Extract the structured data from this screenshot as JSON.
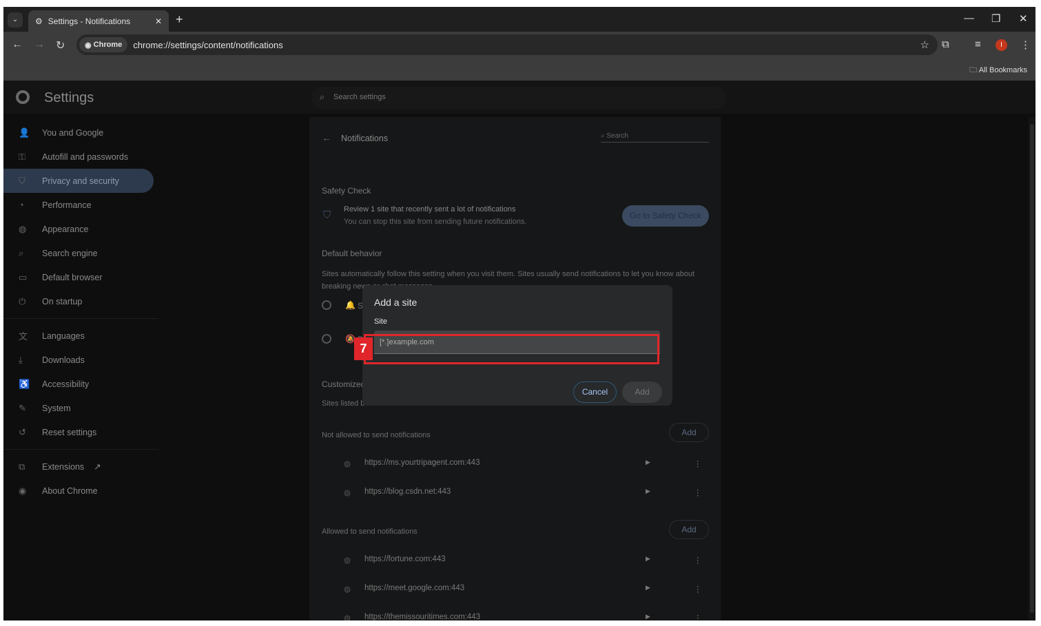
{
  "browser": {
    "tab_title": "Settings - Notifications",
    "chip_label": "Chrome",
    "url": "chrome://settings/content/notifications",
    "bookmarks_label": "All Bookmarks",
    "profile_initial": "I"
  },
  "settings": {
    "title": "Settings",
    "search_placeholder": "Search settings",
    "sidebar": [
      {
        "label": "You and Google",
        "icon": "person-icon"
      },
      {
        "label": "Autofill and passwords",
        "icon": "key-icon"
      },
      {
        "label": "Privacy and security",
        "icon": "shield-icon",
        "active": true
      },
      {
        "label": "Performance",
        "icon": "speedometer-icon"
      },
      {
        "label": "Appearance",
        "icon": "palette-icon"
      },
      {
        "label": "Search engine",
        "icon": "search-icon"
      },
      {
        "label": "Default browser",
        "icon": "browser-icon"
      },
      {
        "label": "On startup",
        "icon": "power-icon"
      },
      {
        "label": "Languages",
        "icon": "translate-icon"
      },
      {
        "label": "Downloads",
        "icon": "download-icon"
      },
      {
        "label": "Accessibility",
        "icon": "accessibility-icon"
      },
      {
        "label": "System",
        "icon": "wrench-icon"
      },
      {
        "label": "Reset settings",
        "icon": "reset-icon"
      },
      {
        "label": "Extensions",
        "icon": "puzzle-icon"
      },
      {
        "label": "About Chrome",
        "icon": "chrome-icon"
      }
    ]
  },
  "page": {
    "title": "Notifications",
    "search_placeholder": "Search",
    "safety_heading": "Safety Check",
    "safety_title": "Review 1 site that recently sent a lot of notifications",
    "safety_sub": "You can stop this site from sending future notifications.",
    "safety_button": "Go to Safety Check",
    "default_heading": "Default behavior",
    "default_desc": "Sites automatically follow this setting when you visit them. Sites usually send notifications to let you know about breaking news or chat messages.",
    "radio1_partial": "Si",
    "radio2_partial": "D",
    "custom_heading": "Customized",
    "custom_desc_partial": "Sites listed b",
    "not_allowed_heading": "Not allowed to send notifications",
    "allowed_heading": "Allowed to send notifications",
    "add_label": "Add",
    "not_allowed": [
      "https://ms.yourtripagent.com:443",
      "https://blog.csdn.net:443"
    ],
    "allowed": [
      "https://fortune.com:443",
      "https://meet.google.com:443",
      "https://themissouritimes.com:443"
    ]
  },
  "dialog": {
    "title": "Add a site",
    "site_label": "Site",
    "site_placeholder": "[*.]example.com",
    "cancel": "Cancel",
    "add": "Add"
  },
  "annotation": {
    "label": "7",
    "color": "#e0262b"
  }
}
